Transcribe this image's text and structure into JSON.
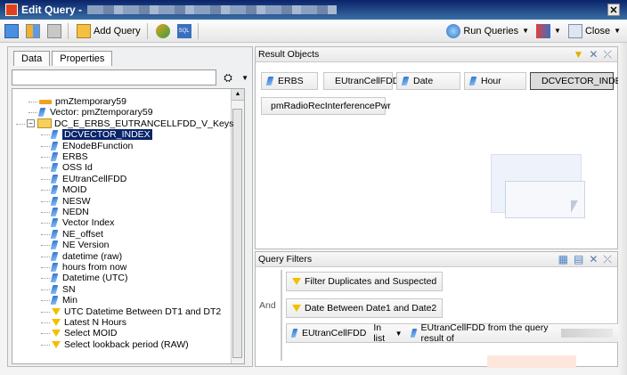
{
  "window": {
    "title": "Edit Query -"
  },
  "toolbar": {
    "add_query": "Add Query",
    "run_queries": "Run Queries",
    "close": "Close",
    "sql_icon_text": "SQL"
  },
  "left_panel": {
    "tabs": [
      "Data",
      "Properties"
    ],
    "tree": [
      {
        "label": "pmZtemporary59",
        "icon": "measure-icon",
        "indent": 52
      },
      {
        "label": "Vector: pmZtemporary59",
        "icon": "dimension-icon",
        "indent": 52
      },
      {
        "label": "DC_E_ERBS_EUTRANCELLFDD_V_Keys",
        "icon": "folder-icon",
        "indent": 38
      },
      {
        "label": "DCVECTOR_INDEX",
        "icon": "dimension-icon",
        "indent": 66,
        "selected": true
      },
      {
        "label": "ENodeBFunction",
        "icon": "dimension-icon",
        "indent": 66
      },
      {
        "label": "ERBS",
        "icon": "dimension-icon",
        "indent": 66
      },
      {
        "label": "OSS Id",
        "icon": "dimension-icon",
        "indent": 66
      },
      {
        "label": "EUtranCellFDD",
        "icon": "dimension-icon",
        "indent": 66
      },
      {
        "label": "MOID",
        "icon": "dimension-icon",
        "indent": 66
      },
      {
        "label": "NESW",
        "icon": "dimension-icon",
        "indent": 66
      },
      {
        "label": "NEDN",
        "icon": "dimension-icon",
        "indent": 66
      },
      {
        "label": "Vector Index",
        "icon": "dimension-icon",
        "indent": 66
      },
      {
        "label": "NE_offset",
        "icon": "dimension-icon",
        "indent": 66
      },
      {
        "label": "NE Version",
        "icon": "dimension-icon",
        "indent": 66
      },
      {
        "label": "datetime (raw)",
        "icon": "dimension-icon",
        "indent": 66
      },
      {
        "label": "hours from now",
        "icon": "dimension-icon",
        "indent": 66
      },
      {
        "label": "Datetime (UTC)",
        "icon": "dimension-icon",
        "indent": 66
      },
      {
        "label": "SN",
        "icon": "dimension-icon",
        "indent": 66
      },
      {
        "label": "Min",
        "icon": "dimension-icon",
        "indent": 66
      },
      {
        "label": "UTC Datetime Between DT1 and DT2",
        "icon": "filter-icon",
        "indent": 66
      },
      {
        "label": "Latest N Hours",
        "icon": "filter-icon",
        "indent": 66
      },
      {
        "label": "Select MOID",
        "icon": "filter-icon",
        "indent": 66
      },
      {
        "label": "Select lookback period (RAW)",
        "icon": "filter-icon",
        "indent": 66
      }
    ]
  },
  "result_objects": {
    "title": "Result Objects",
    "chips": [
      {
        "label": "ERBS"
      },
      {
        "label": "EUtranCellFDD"
      },
      {
        "label": "Date"
      },
      {
        "label": "Hour"
      },
      {
        "label": "DCVECTOR_INDEX",
        "selected": true
      },
      {
        "label": "pmRadioRecInterferencePwr",
        "measure": true
      }
    ]
  },
  "query_filters": {
    "title": "Query Filters",
    "operator": "And",
    "filters": [
      {
        "label": "Filter Duplicates and Suspected"
      },
      {
        "label": "Date Between Date1 and Date2"
      }
    ],
    "condition": {
      "object": "EUtranCellFDD",
      "operator": "In list",
      "value": "EUtranCellFDD from the query result of"
    }
  }
}
